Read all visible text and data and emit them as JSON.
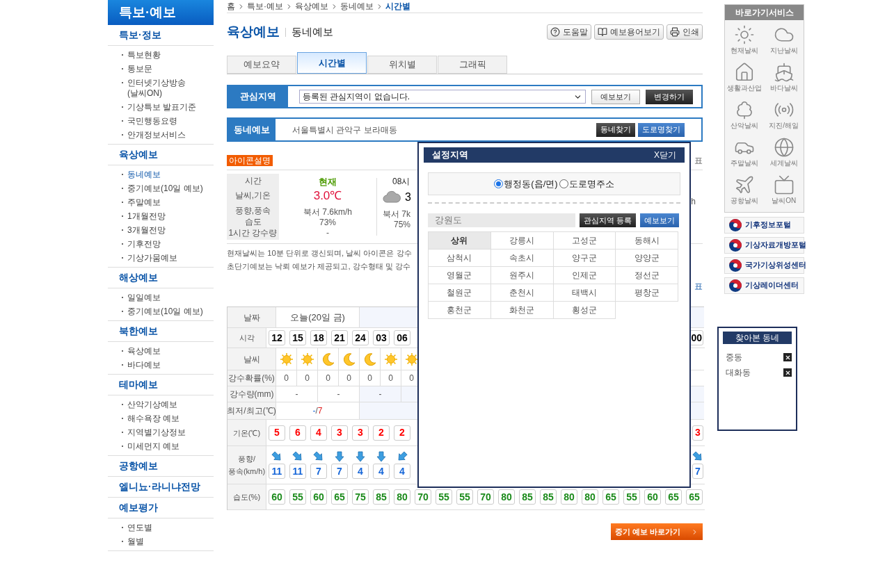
{
  "sidebar": {
    "title": "특보·예보",
    "sections": [
      {
        "title": "특보·정보",
        "items": [
          {
            "label": "특보현황",
            "selected": false
          },
          {
            "label": "통보문",
            "selected": false
          },
          {
            "label": "인터넷기상방송\n(날씨ON)",
            "selected": false
          },
          {
            "label": "기상특보 발표기준",
            "selected": false
          },
          {
            "label": "국민행동요령",
            "selected": false
          },
          {
            "label": "안개정보서비스",
            "selected": false
          }
        ]
      },
      {
        "title": "육상예보",
        "items": [
          {
            "label": "동네예보",
            "selected": true
          },
          {
            "label": "중기예보(10일 예보)",
            "selected": false
          },
          {
            "label": "주말예보",
            "selected": false
          },
          {
            "label": "1개월전망",
            "selected": false
          },
          {
            "label": "3개월전망",
            "selected": false
          },
          {
            "label": "기후전망",
            "selected": false
          },
          {
            "label": "기상가뭄예보",
            "selected": false
          }
        ]
      },
      {
        "title": "해상예보",
        "items": [
          {
            "label": "일일예보",
            "selected": false
          },
          {
            "label": "중기예보(10일 예보)",
            "selected": false
          }
        ]
      },
      {
        "title": "북한예보",
        "items": [
          {
            "label": "육상예보",
            "selected": false
          },
          {
            "label": "바다예보",
            "selected": false
          }
        ]
      },
      {
        "title": "테마예보",
        "items": [
          {
            "label": "산악기상예보",
            "selected": false
          },
          {
            "label": "해수욕장 예보",
            "selected": false
          },
          {
            "label": "지역별기상정보",
            "selected": false
          },
          {
            "label": "미세먼지 예보",
            "selected": false
          }
        ]
      },
      {
        "title": "공항예보"
      },
      {
        "title": "엘니뇨·라니냐전망"
      },
      {
        "title": "예보평가",
        "items": [
          {
            "label": "연도별",
            "selected": false
          },
          {
            "label": "월별",
            "selected": false
          }
        ]
      }
    ]
  },
  "breadcrumb": [
    "홈",
    "특보·예보",
    "육상예보",
    "동네예보",
    "시간별"
  ],
  "page_title": "육상예보",
  "page_subtitle": "동네예보",
  "tool_buttons": [
    "도움말",
    "예보용어보기",
    "인쇄"
  ],
  "tabs": [
    {
      "label": "예보요약",
      "selected": false
    },
    {
      "label": "시간별",
      "selected": true
    },
    {
      "label": "위치별",
      "selected": false
    },
    {
      "label": "그래픽",
      "selected": false
    }
  ],
  "interest_area": {
    "label": "관심지역",
    "value": "등록된 관심지역이 없습니다.",
    "buttons": [
      {
        "label": "예보보기",
        "kind": "light"
      },
      {
        "label": "변경하기",
        "kind": "dark"
      }
    ]
  },
  "town_forecast": {
    "label": "동네예보",
    "address": "서울특별시 관악구 보라매동",
    "buttons": [
      {
        "label": "동네찾기",
        "kind": "dark"
      },
      {
        "label": "도로명찾기",
        "kind": "blue"
      }
    ]
  },
  "icon_legend_button": "아이콘설명",
  "announce_top": "표",
  "announce_bottom": "표",
  "current": {
    "row_labels": [
      "시간",
      "날씨,기온",
      "풍향,풍속",
      "습도",
      "1시간 강수량"
    ],
    "now": {
      "title": "현재",
      "temp": "3.0℃",
      "wind": "북서 7.6km/h",
      "humidity": "73%",
      "rain": "-"
    },
    "next": {
      "title": "08시",
      "temp": "3",
      "wind": "북서 7k",
      "humidity": "75%"
    },
    "wind_tail": "h"
  },
  "notes": [
    "현재날씨는 10분 단위로 갱신되며, 날씨 아이콘은 강수",
    "초단기예보는 낙뢰 예보가 제공되고, 강수형태 및 강수"
  ],
  "forecast_table": {
    "rows": [
      {
        "kind": "date",
        "label": "날짜",
        "today": "오늘(20일 금)"
      },
      {
        "kind": "time",
        "label": "시각",
        "values": [
          "12",
          "15",
          "18",
          "21",
          "24",
          "03",
          "06"
        ],
        "last": "00"
      },
      {
        "kind": "icons",
        "label": "날씨",
        "icons": [
          {
            "kind": "sun"
          },
          {
            "kind": "sun"
          },
          {
            "kind": "moon"
          },
          {
            "kind": "moon"
          },
          {
            "kind": "moon"
          },
          {
            "kind": "sun"
          },
          {
            "kind": "sun"
          }
        ]
      },
      {
        "kind": "plain",
        "label": "강수확률(%)",
        "values": [
          "0",
          "0",
          "0",
          "0",
          "0",
          "0",
          "0"
        ]
      },
      {
        "kind": "span2",
        "label": "강수량(mm)",
        "values": [
          "-",
          "-",
          "-"
        ]
      },
      {
        "kind": "minmax",
        "label": "최저/최고(℃)",
        "min": "-",
        "sep": "/",
        "max": "7"
      },
      {
        "kind": "temp",
        "label": "기온(℃)",
        "values": [
          "5",
          "6",
          "4",
          "3",
          "3",
          "2",
          "2"
        ],
        "last": "3"
      },
      {
        "kind": "wind",
        "label": "풍향/\n풍속(km/h)",
        "values": [
          {
            "kind": "se",
            "speed": "11"
          },
          {
            "kind": "se",
            "speed": "11"
          },
          {
            "kind": "se",
            "speed": "7"
          },
          {
            "kind": "s",
            "speed": "7"
          },
          {
            "kind": "s",
            "speed": "4"
          },
          {
            "kind": "s",
            "speed": "4"
          },
          {
            "kind": "sw",
            "speed": "4"
          }
        ],
        "last": {
          "kind": "se",
          "speed": "7"
        }
      },
      {
        "kind": "humidity",
        "label": "습도(%)",
        "values": [
          "60",
          "55",
          "60",
          "65",
          "75",
          "85",
          "80",
          "70",
          "55",
          "55",
          "70",
          "80",
          "85",
          "85",
          "80",
          "80",
          "65",
          "55",
          "60",
          "65",
          "65"
        ]
      }
    ]
  },
  "midterm_button": "중기 예보 바로가기",
  "popup": {
    "title": "설정지역",
    "close": "X닫기",
    "options": [
      {
        "label": "행정동(읍/면)",
        "selected": true
      },
      {
        "label": "도로명주소",
        "selected": false
      }
    ],
    "province": "강원도",
    "buttons": [
      {
        "label": "관심지역 등록",
        "kind": "dark"
      },
      {
        "label": "예보보기",
        "kind": "blue"
      }
    ],
    "regions": [
      {
        "label": "상위",
        "selected": true
      },
      {
        "label": "강릉시",
        "selected": false
      },
      {
        "label": "고성군",
        "selected": false
      },
      {
        "label": "동해시",
        "selected": false
      },
      {
        "label": "삼척시",
        "selected": false
      },
      {
        "label": "속초시",
        "selected": false
      },
      {
        "label": "양구군",
        "selected": false
      },
      {
        "label": "양양군",
        "selected": false
      },
      {
        "label": "영월군",
        "selected": false
      },
      {
        "label": "원주시",
        "selected": false
      },
      {
        "label": "인제군",
        "selected": false
      },
      {
        "label": "정선군",
        "selected": false
      },
      {
        "label": "철원군",
        "selected": false
      },
      {
        "label": "춘천시",
        "selected": false
      },
      {
        "label": "태백시",
        "selected": false
      },
      {
        "label": "평창군",
        "selected": false
      },
      {
        "label": "홍천군",
        "selected": false
      },
      {
        "label": "화천군",
        "selected": false
      },
      {
        "label": "횡성군",
        "selected": false
      }
    ]
  },
  "quick_services": {
    "title": "바로가기서비스",
    "items": [
      "현재날씨",
      "지난날씨",
      "생활과산업",
      "바다날씨",
      "산악날씨",
      "지진/해일",
      "주말날씨",
      "세계날씨",
      "공항날씨",
      "날씨ON"
    ]
  },
  "portals": [
    "기후정보포털",
    "기상자료개방포털",
    "국가기상위성센터",
    "기상레이더센터"
  ],
  "recent_towns": {
    "title": "찾아본 동네",
    "items": [
      "중동",
      "대화동"
    ]
  }
}
